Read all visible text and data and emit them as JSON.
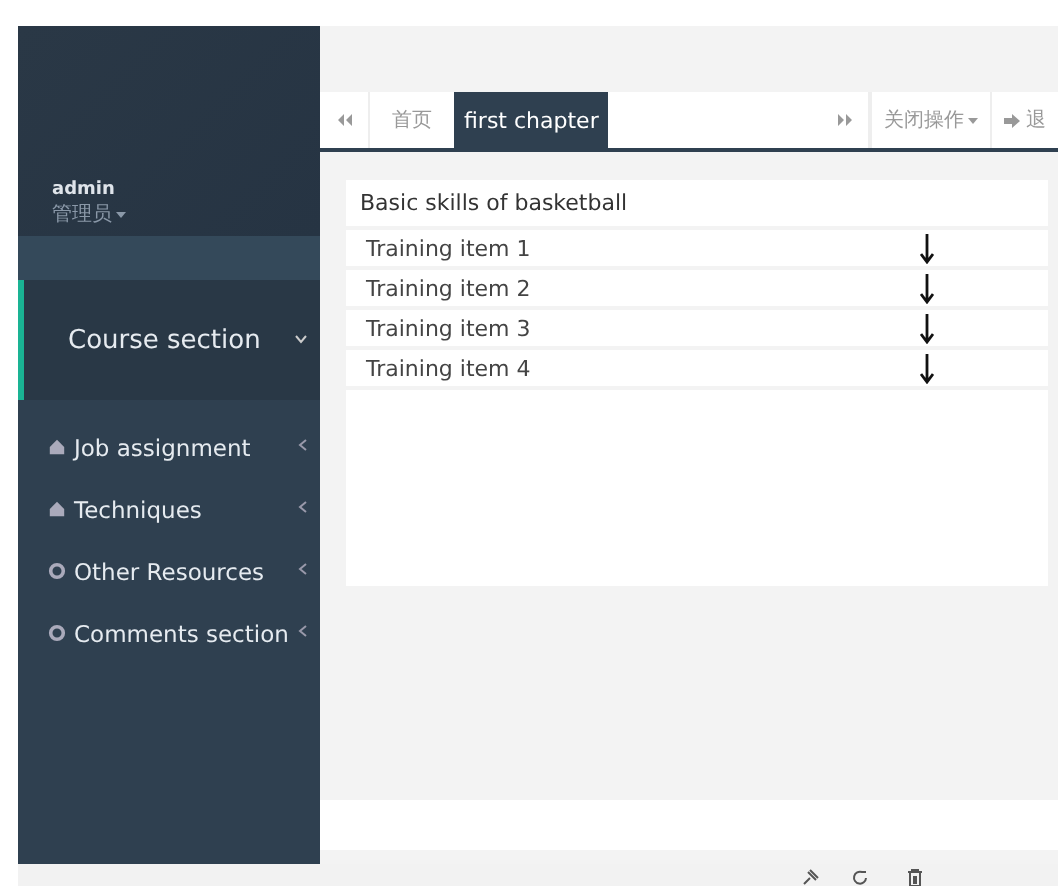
{
  "user": {
    "name": "admin",
    "role": "管理员"
  },
  "menu": [
    {
      "label": "Course section",
      "kind": "section",
      "expanded": true,
      "selected": true
    },
    {
      "label": "Job assignment",
      "kind": "home",
      "expanded": false,
      "selected": false
    },
    {
      "label": "Techniques",
      "kind": "home",
      "expanded": false,
      "selected": false
    },
    {
      "label": "Other Resources",
      "kind": "gear",
      "expanded": false,
      "selected": false
    },
    {
      "label": "Comments section",
      "kind": "gear",
      "expanded": false,
      "selected": false
    }
  ],
  "tabs": [
    {
      "label": "首页",
      "selected": false
    },
    {
      "label": "first chapter",
      "selected": true
    }
  ],
  "tab_actions": {
    "close_menu": "关闭操作",
    "logout": "退"
  },
  "panel": {
    "title": "Basic skills of basketball",
    "items": [
      "Training item 1",
      "Training item 2",
      "Training item 3",
      "Training item 4"
    ]
  }
}
